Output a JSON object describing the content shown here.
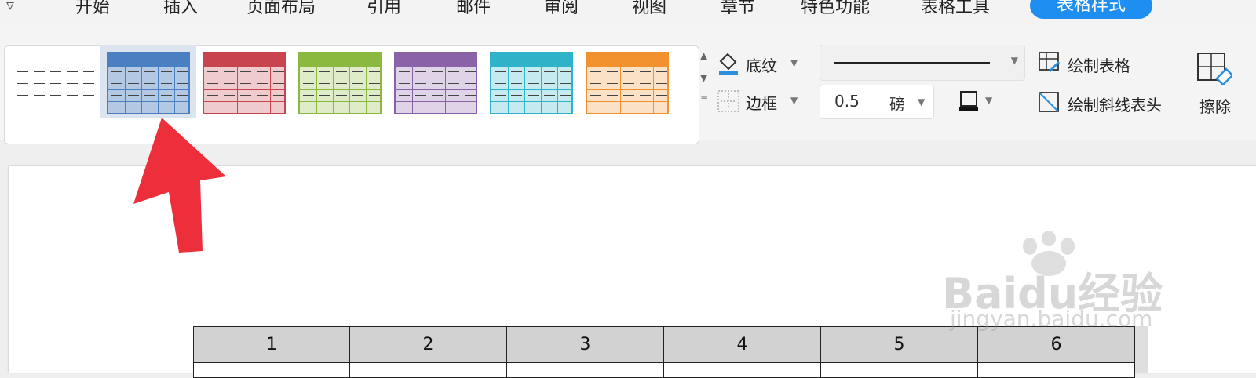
{
  "menu": {
    "tabs": [
      "开始",
      "插入",
      "页面布局",
      "引用",
      "邮件",
      "审阅",
      "视图",
      "章节",
      "特色功能",
      "表格工具"
    ],
    "active_tab": "表格样式",
    "active_color": "#1e8ff0"
  },
  "ribbon": {
    "shading_label": "底纹",
    "border_label": "边框",
    "line_width_value": "0.5",
    "line_width_unit": "磅",
    "draw_table_label": "绘制表格",
    "draw_diagonal_label": "绘制斜线表头",
    "erase_label": "擦除"
  },
  "table_styles": [
    {
      "name": "plain",
      "color": "#777777"
    },
    {
      "name": "blue",
      "color": "#4a7fc1"
    },
    {
      "name": "red",
      "color": "#c84550"
    },
    {
      "name": "green",
      "color": "#8bb83e"
    },
    {
      "name": "purple",
      "color": "#8a62a8"
    },
    {
      "name": "teal",
      "color": "#2fb3c8"
    },
    {
      "name": "orange",
      "color": "#f2922e"
    }
  ],
  "selected_style": "blue",
  "document": {
    "table_header": [
      "1",
      "2",
      "3",
      "4",
      "5",
      "6"
    ]
  },
  "watermark": {
    "brand_text": "Baidu经验",
    "url_text": "jingyan.baidu.com"
  }
}
